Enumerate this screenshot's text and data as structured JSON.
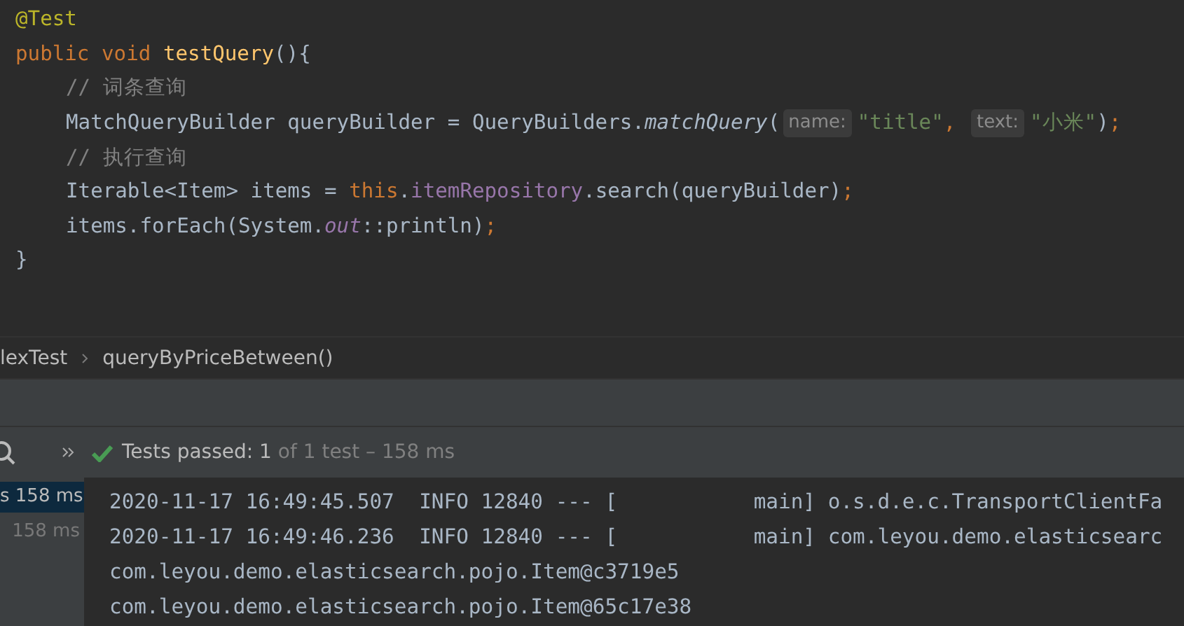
{
  "code": {
    "lines": [
      {
        "tokens": [
          {
            "kind": "annotation",
            "text": "@Test"
          }
        ]
      },
      {
        "tokens": [
          {
            "kind": "keyword",
            "text": "public void "
          },
          {
            "kind": "method",
            "text": "testQuery"
          },
          {
            "kind": "plain",
            "text": "(){"
          }
        ],
        "children": [
          {
            "tokens": [
              {
                "kind": "comment",
                "text": "// 词条查询"
              }
            ]
          },
          {
            "tokens": [
              {
                "kind": "plain",
                "text": "MatchQueryBuilder queryBuilder = QueryBuilders."
              },
              {
                "kind": "static",
                "text": "matchQuery"
              },
              {
                "kind": "plain",
                "text": "("
              },
              {
                "kind": "hint",
                "text": "name:"
              },
              {
                "kind": "string",
                "text": "\"title\""
              },
              {
                "kind": "keyword",
                "text": ", "
              },
              {
                "kind": "hint",
                "text": "text:"
              },
              {
                "kind": "string",
                "text": "\"小米\""
              },
              {
                "kind": "plain",
                "text": ")"
              },
              {
                "kind": "keyword",
                "text": ";"
              }
            ]
          },
          {
            "tokens": [
              {
                "kind": "comment",
                "text": "// 执行查询"
              }
            ]
          },
          {
            "tokens": [
              {
                "kind": "plain",
                "text": "Iterable<Item> items = "
              },
              {
                "kind": "keyword",
                "text": "this"
              },
              {
                "kind": "plain",
                "text": "."
              },
              {
                "kind": "field",
                "text": "itemRepository"
              },
              {
                "kind": "plain",
                "text": ".search(queryBuilder)"
              },
              {
                "kind": "keyword",
                "text": ";"
              }
            ]
          },
          {
            "tokens": [
              {
                "kind": "plain",
                "text": "items.forEach(System."
              },
              {
                "kind": "static_field",
                "text": "out"
              },
              {
                "kind": "plain",
                "text": "::println)"
              },
              {
                "kind": "keyword",
                "text": ";"
              }
            ]
          }
        ]
      },
      {
        "tokens": [
          {
            "kind": "plain",
            "text": "}"
          }
        ]
      }
    ]
  },
  "breadcrumb": [
    "lexTest",
    "queryByPriceBetween()"
  ],
  "test_status": {
    "label": "Tests passed: 1",
    "detail": " of 1 test – 158 ms"
  },
  "test_tree": [
    {
      "label": "s 158 ms",
      "selected": true
    },
    {
      "label": "158 ms",
      "selected": false
    }
  ],
  "console": [
    "2020-11-17 16:49:45.507  INFO 12840 --- [           main] o.s.d.e.c.TransportClientFa",
    "2020-11-17 16:49:46.236  INFO 12840 --- [           main] com.leyou.demo.elasticsearc",
    "com.leyou.demo.elasticsearch.pojo.Item@c3719e5",
    "com.leyou.demo.elasticsearch.pojo.Item@65c17e38"
  ]
}
